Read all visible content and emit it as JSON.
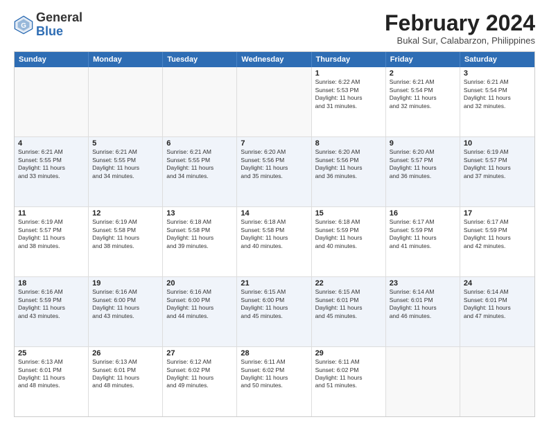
{
  "logo": {
    "general": "General",
    "blue": "Blue"
  },
  "title": "February 2024",
  "subtitle": "Bukal Sur, Calabarzon, Philippines",
  "days": [
    "Sunday",
    "Monday",
    "Tuesday",
    "Wednesday",
    "Thursday",
    "Friday",
    "Saturday"
  ],
  "weeks": [
    [
      {
        "day": "",
        "info": ""
      },
      {
        "day": "",
        "info": ""
      },
      {
        "day": "",
        "info": ""
      },
      {
        "day": "",
        "info": ""
      },
      {
        "day": "1",
        "info": "Sunrise: 6:22 AM\nSunset: 5:53 PM\nDaylight: 11 hours\nand 31 minutes."
      },
      {
        "day": "2",
        "info": "Sunrise: 6:21 AM\nSunset: 5:54 PM\nDaylight: 11 hours\nand 32 minutes."
      },
      {
        "day": "3",
        "info": "Sunrise: 6:21 AM\nSunset: 5:54 PM\nDaylight: 11 hours\nand 32 minutes."
      }
    ],
    [
      {
        "day": "4",
        "info": "Sunrise: 6:21 AM\nSunset: 5:55 PM\nDaylight: 11 hours\nand 33 minutes."
      },
      {
        "day": "5",
        "info": "Sunrise: 6:21 AM\nSunset: 5:55 PM\nDaylight: 11 hours\nand 34 minutes."
      },
      {
        "day": "6",
        "info": "Sunrise: 6:21 AM\nSunset: 5:55 PM\nDaylight: 11 hours\nand 34 minutes."
      },
      {
        "day": "7",
        "info": "Sunrise: 6:20 AM\nSunset: 5:56 PM\nDaylight: 11 hours\nand 35 minutes."
      },
      {
        "day": "8",
        "info": "Sunrise: 6:20 AM\nSunset: 5:56 PM\nDaylight: 11 hours\nand 36 minutes."
      },
      {
        "day": "9",
        "info": "Sunrise: 6:20 AM\nSunset: 5:57 PM\nDaylight: 11 hours\nand 36 minutes."
      },
      {
        "day": "10",
        "info": "Sunrise: 6:19 AM\nSunset: 5:57 PM\nDaylight: 11 hours\nand 37 minutes."
      }
    ],
    [
      {
        "day": "11",
        "info": "Sunrise: 6:19 AM\nSunset: 5:57 PM\nDaylight: 11 hours\nand 38 minutes."
      },
      {
        "day": "12",
        "info": "Sunrise: 6:19 AM\nSunset: 5:58 PM\nDaylight: 11 hours\nand 38 minutes."
      },
      {
        "day": "13",
        "info": "Sunrise: 6:18 AM\nSunset: 5:58 PM\nDaylight: 11 hours\nand 39 minutes."
      },
      {
        "day": "14",
        "info": "Sunrise: 6:18 AM\nSunset: 5:58 PM\nDaylight: 11 hours\nand 40 minutes."
      },
      {
        "day": "15",
        "info": "Sunrise: 6:18 AM\nSunset: 5:59 PM\nDaylight: 11 hours\nand 40 minutes."
      },
      {
        "day": "16",
        "info": "Sunrise: 6:17 AM\nSunset: 5:59 PM\nDaylight: 11 hours\nand 41 minutes."
      },
      {
        "day": "17",
        "info": "Sunrise: 6:17 AM\nSunset: 5:59 PM\nDaylight: 11 hours\nand 42 minutes."
      }
    ],
    [
      {
        "day": "18",
        "info": "Sunrise: 6:16 AM\nSunset: 5:59 PM\nDaylight: 11 hours\nand 43 minutes."
      },
      {
        "day": "19",
        "info": "Sunrise: 6:16 AM\nSunset: 6:00 PM\nDaylight: 11 hours\nand 43 minutes."
      },
      {
        "day": "20",
        "info": "Sunrise: 6:16 AM\nSunset: 6:00 PM\nDaylight: 11 hours\nand 44 minutes."
      },
      {
        "day": "21",
        "info": "Sunrise: 6:15 AM\nSunset: 6:00 PM\nDaylight: 11 hours\nand 45 minutes."
      },
      {
        "day": "22",
        "info": "Sunrise: 6:15 AM\nSunset: 6:01 PM\nDaylight: 11 hours\nand 45 minutes."
      },
      {
        "day": "23",
        "info": "Sunrise: 6:14 AM\nSunset: 6:01 PM\nDaylight: 11 hours\nand 46 minutes."
      },
      {
        "day": "24",
        "info": "Sunrise: 6:14 AM\nSunset: 6:01 PM\nDaylight: 11 hours\nand 47 minutes."
      }
    ],
    [
      {
        "day": "25",
        "info": "Sunrise: 6:13 AM\nSunset: 6:01 PM\nDaylight: 11 hours\nand 48 minutes."
      },
      {
        "day": "26",
        "info": "Sunrise: 6:13 AM\nSunset: 6:01 PM\nDaylight: 11 hours\nand 48 minutes."
      },
      {
        "day": "27",
        "info": "Sunrise: 6:12 AM\nSunset: 6:02 PM\nDaylight: 11 hours\nand 49 minutes."
      },
      {
        "day": "28",
        "info": "Sunrise: 6:11 AM\nSunset: 6:02 PM\nDaylight: 11 hours\nand 50 minutes."
      },
      {
        "day": "29",
        "info": "Sunrise: 6:11 AM\nSunset: 6:02 PM\nDaylight: 11 hours\nand 51 minutes."
      },
      {
        "day": "",
        "info": ""
      },
      {
        "day": "",
        "info": ""
      }
    ]
  ]
}
